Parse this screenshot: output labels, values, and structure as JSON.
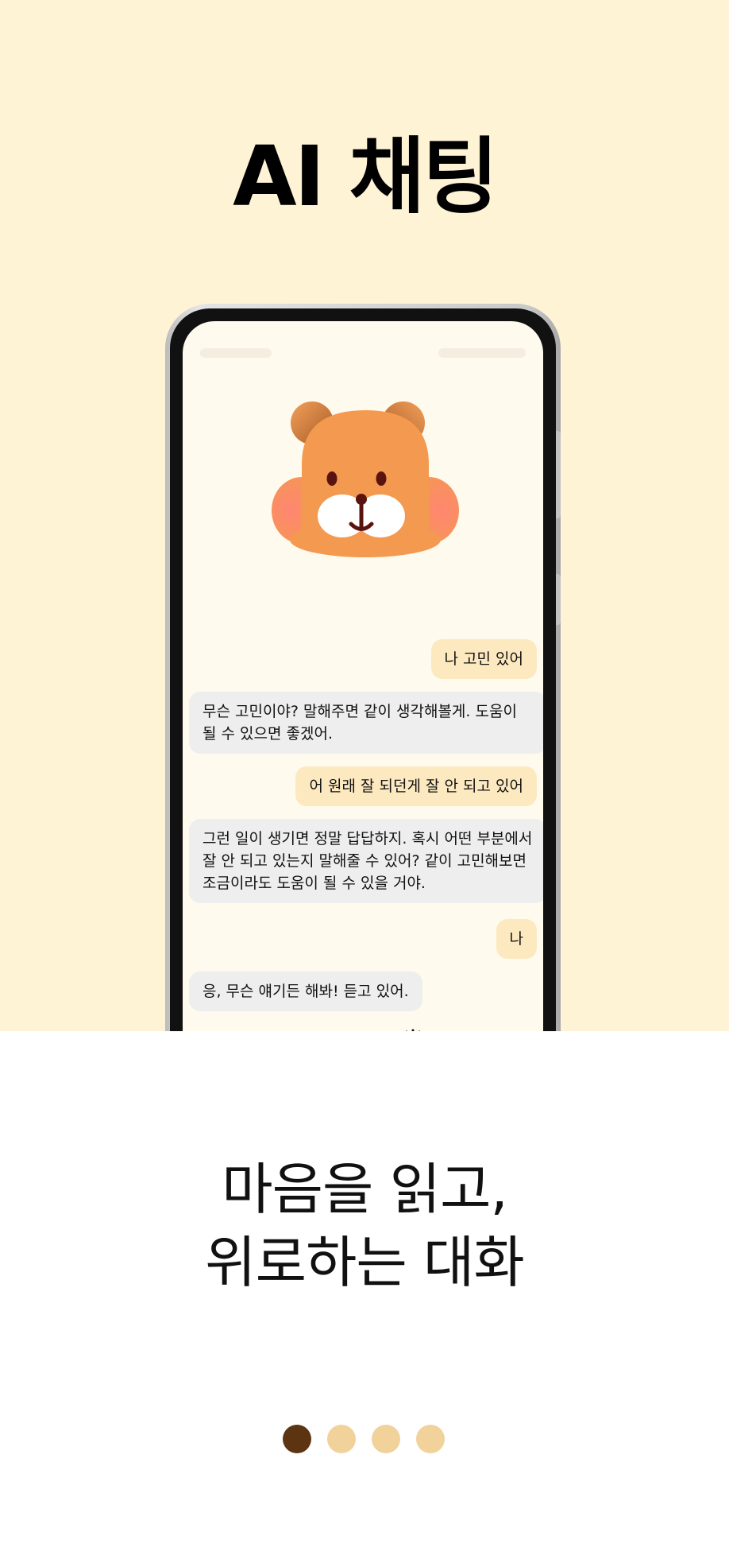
{
  "header": {
    "title": "AI 채팅"
  },
  "chat": {
    "messages": [
      {
        "role": "user",
        "text": "나 고민 있어"
      },
      {
        "role": "ai",
        "text": "무슨 고민이야? 말해주면 같이 생각해볼게. 도움이 될 수 있으면 좋겠어."
      },
      {
        "role": "user",
        "text": "어 원래 잘 되던게 잘 안 되고 있어"
      },
      {
        "role": "ai",
        "text": "그런 일이 생기면 정말 답답하지. 혹시 어떤 부분에서 잘 안 되고 있는지 말해줄 수 있어? 같이 고민해보면 조금이라도 도움이 될 수 있을 거야."
      },
      {
        "role": "user",
        "text": "나"
      },
      {
        "role": "ai",
        "text": "응, 무슨 얘기든 해봐! 듣고 있어."
      }
    ]
  },
  "tagline": {
    "line1": "마음을 읽고,",
    "line2": "위로하는 대화"
  },
  "pagination": {
    "total": 4,
    "current": 1
  },
  "colors": {
    "top_background": "#fff3d6",
    "user_bubble": "#fde9c0",
    "ai_bubble": "#eeeeee",
    "dot_active": "#5c3412",
    "dot_inactive": "#f2d29b",
    "mascot_fur": "#f49a50"
  },
  "icons": {
    "mascot": "hamster-mascot-icon"
  }
}
